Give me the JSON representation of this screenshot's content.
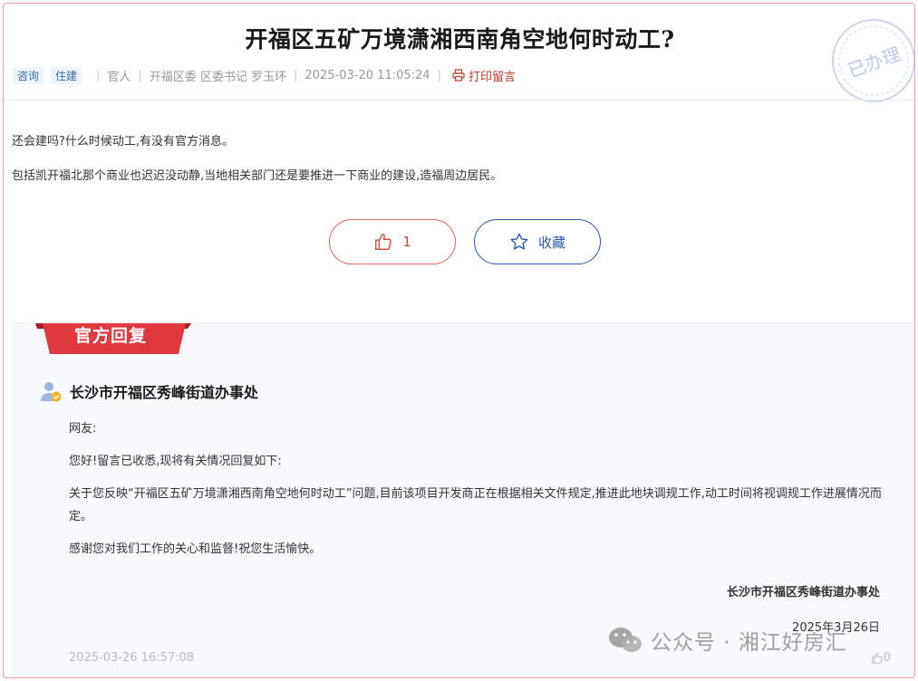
{
  "post": {
    "title": "开福区五矿万境潇湘西南角空地何时动工?",
    "tags": [
      "咨询",
      "住建"
    ],
    "recipient_label": "官人",
    "recipient": "开福区委 区委书记 罗玉环",
    "time": "2025-03-20 11:05:24",
    "print_label": "打印留言",
    "status_stamp": "已办理",
    "body": [
      "还会建吗?什么时候动工,有没有官方消息。",
      "包括凯开福北那个商业也迟迟没动静,当地相关部门还是要推进一下商业的建设,造福周边居民。"
    ],
    "like_count": "1",
    "favorite_label": "收藏"
  },
  "reply": {
    "ribbon": "官方回复",
    "org": "长沙市开福区秀峰街道办事处",
    "paragraphs": [
      "网友:",
      "您好!留言已收悉,现将有关情况回复如下:",
      "关于您反映“开福区五矿万境潇湘西南角空地何时动工”问题,目前该项目开发商正在根据相关文件规定,推进此地块调规工作,动工时间将视调规工作进展情况而定。",
      "感谢您对我们工作的关心和监督!祝您生活愉快。"
    ],
    "signature": "长沙市开福区秀峰街道办事处",
    "signature_date": "2025年3月26日",
    "time": "2025-03-26 16:57:08",
    "like_count": "0"
  },
  "watermark": "公众号 · 湘江好房汇",
  "colors": {
    "accent_red": "#d9363e",
    "accent_blue": "#2d5aa8",
    "tag_bg": "#eef4fb",
    "reply_bg": "#f7f9fc"
  }
}
